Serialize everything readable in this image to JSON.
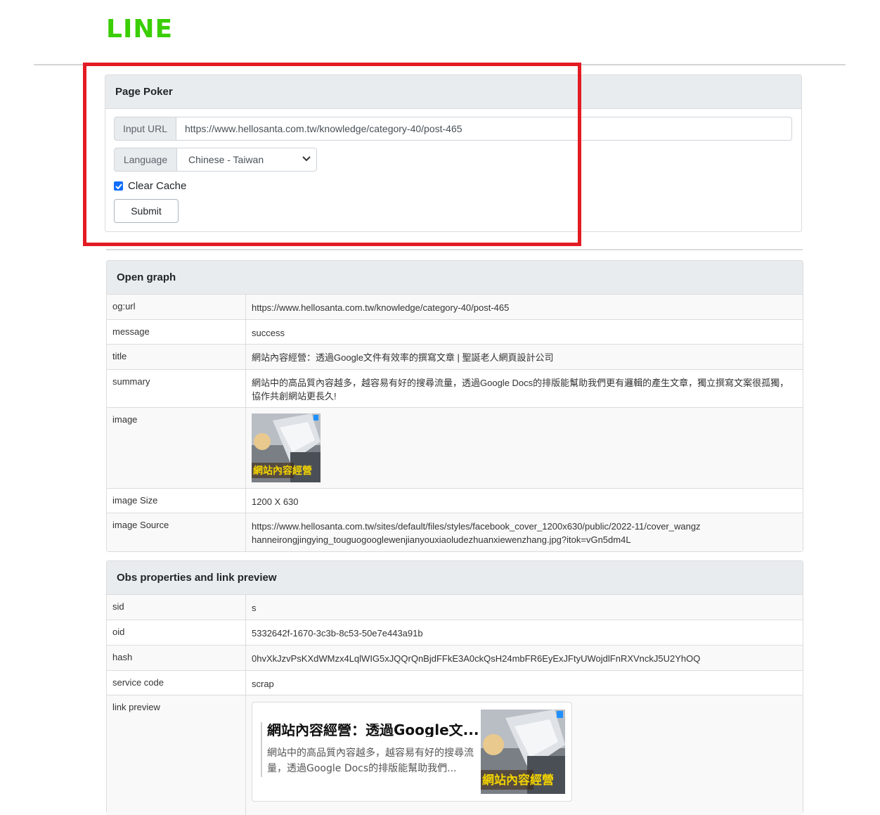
{
  "brand": {
    "logo_text": "LINE",
    "color": "#3ACE01"
  },
  "poker": {
    "title": "Page Poker",
    "url_label": "Input URL",
    "url_value": "https://www.hellosanta.com.tw/knowledge/category-40/post-465",
    "language_label": "Language",
    "language_value": "Chinese - Taiwan",
    "clear_cache_label": "Clear Cache",
    "clear_cache_checked": true,
    "submit_label": "Submit"
  },
  "open_graph": {
    "title": "Open graph",
    "rows": [
      {
        "key": "og:url",
        "value": "https://www.hellosanta.com.tw/knowledge/category-40/post-465"
      },
      {
        "key": "message",
        "value": "success"
      },
      {
        "key": "title",
        "value": "網站內容經營：透過Google文件有效率的撰寫文章 | 聖誕老人網頁設計公司"
      },
      {
        "key": "summary",
        "value": "網站中的高品質內容越多，越容易有好的搜尋流量，透過Google Docs的排版能幫助我們更有邏輯的產生文章，獨立撰寫文案很孤獨，協作共創網站更長久!"
      },
      {
        "key": "image",
        "value": ""
      },
      {
        "key": "image Size",
        "value": "1200 X 630"
      },
      {
        "key": "image Source",
        "value": "https://www.hellosanta.com.tw/sites/default/files/styles/facebook_cover_1200x630/public/2022-11/cover_wangzhanneirongjingying_touguogooglewenjianyouxiaoludezhuanxiewenzhang.jpg?itok=vGn5dm4L"
      }
    ]
  },
  "obs": {
    "title": "Obs properties and link preview",
    "rows": [
      {
        "key": "sid",
        "value": "s"
      },
      {
        "key": "oid",
        "value": "5332642f-1670-3c3b-8c53-50e7e443a91b"
      },
      {
        "key": "hash",
        "value": "0hvXkJzvPsKXdWMzx4LqlWIG5xJQQrQnBjdFFkE3A0ckQsH24mbFR6EyExJFtyUWojdlFnRXVnckJ5U2YhOQ"
      },
      {
        "key": "service code",
        "value": "scrap"
      },
      {
        "key": "link preview",
        "value": ""
      }
    ],
    "preview": {
      "title": "網站內容經營：透過Google文...",
      "description": "網站中的高品質內容越多，越容易有好的搜尋流量，透過Google Docs的排版能幫助我們..."
    }
  },
  "thumbnail": {
    "caption": "網站內容經營"
  }
}
